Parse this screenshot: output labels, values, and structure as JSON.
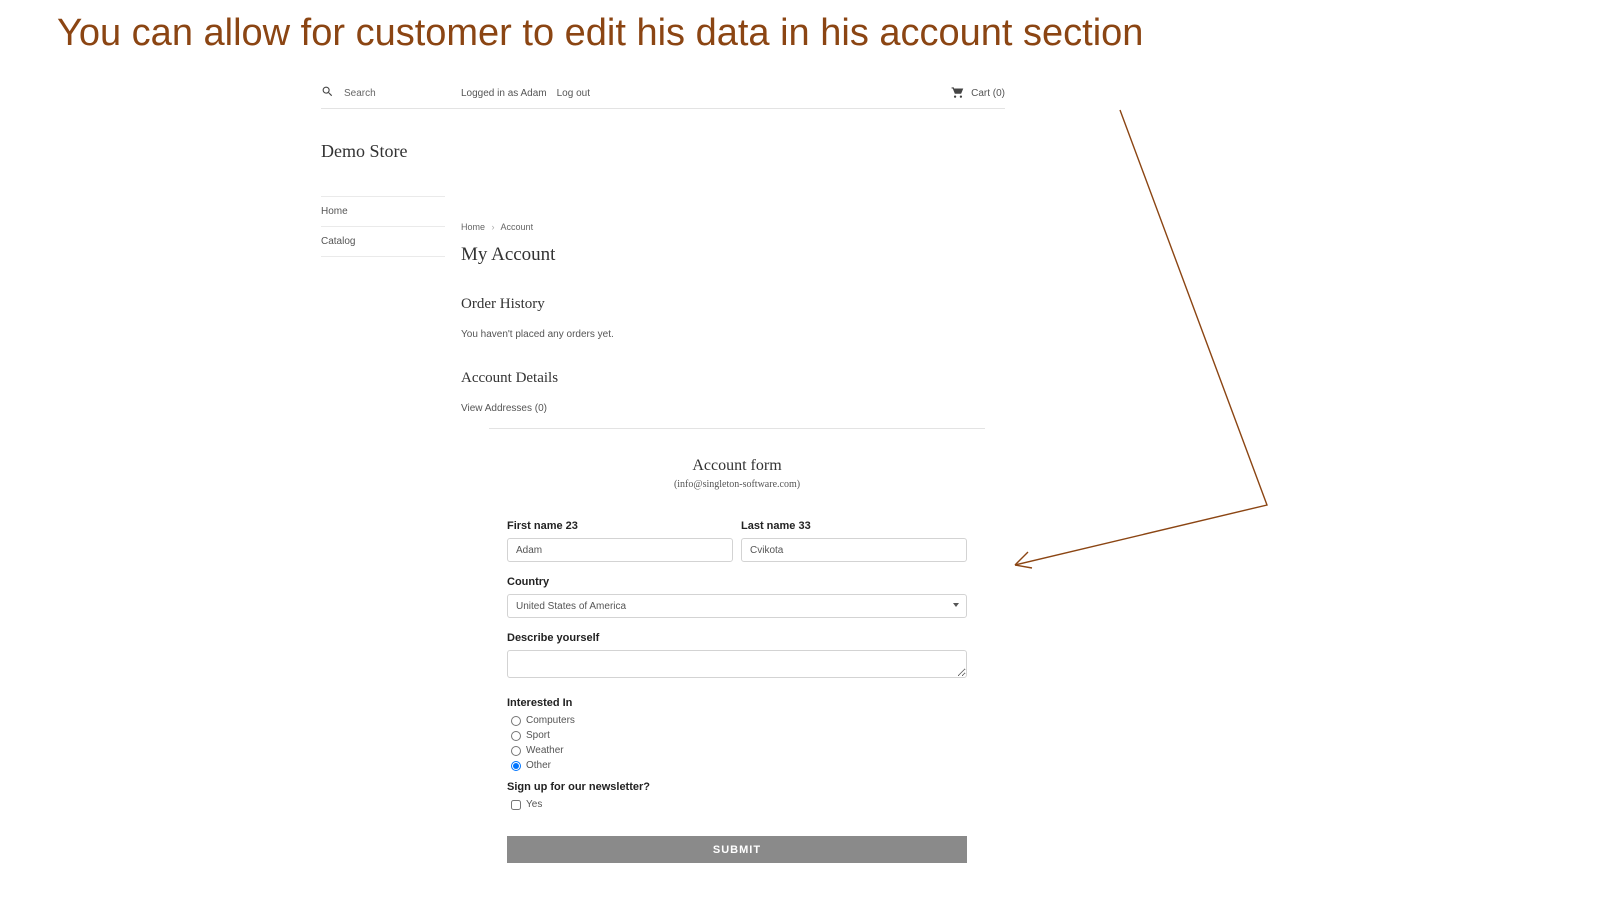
{
  "headline": "You can allow for customer to edit his data in his account section",
  "topbar": {
    "search_label": "Search",
    "logged_in_label": "Logged in as Adam",
    "logout_label": "Log out",
    "cart_label": "Cart (0)"
  },
  "store_title": "Demo Store",
  "sidenav": {
    "items": [
      {
        "label": "Home"
      },
      {
        "label": "Catalog"
      }
    ]
  },
  "breadcrumbs": {
    "home": "Home",
    "current": "Account"
  },
  "page_title": "My Account",
  "order_history": {
    "title": "Order History",
    "empty_text": "You haven't placed any orders yet."
  },
  "account_details": {
    "title": "Account Details",
    "view_addresses_label": "View Addresses (0)"
  },
  "form": {
    "title": "Account form",
    "subtitle": "(info@singleton-software.com)",
    "first_name_label": "First name 23",
    "first_name_value": "Adam",
    "last_name_label": "Last name 33",
    "last_name_value": "Cvikota",
    "country_label": "Country",
    "country_value": "United States of America",
    "describe_label": "Describe yourself",
    "describe_value": "",
    "interested_label": "Interested In",
    "interested_options": [
      {
        "label": "Computers",
        "checked": false
      },
      {
        "label": "Sport",
        "checked": false
      },
      {
        "label": "Weather",
        "checked": false
      },
      {
        "label": "Other",
        "checked": true
      }
    ],
    "newsletter_label": "Sign up for our newsletter?",
    "newsletter_option_label": "Yes",
    "newsletter_checked": false,
    "submit_label": "SUBMIT"
  }
}
